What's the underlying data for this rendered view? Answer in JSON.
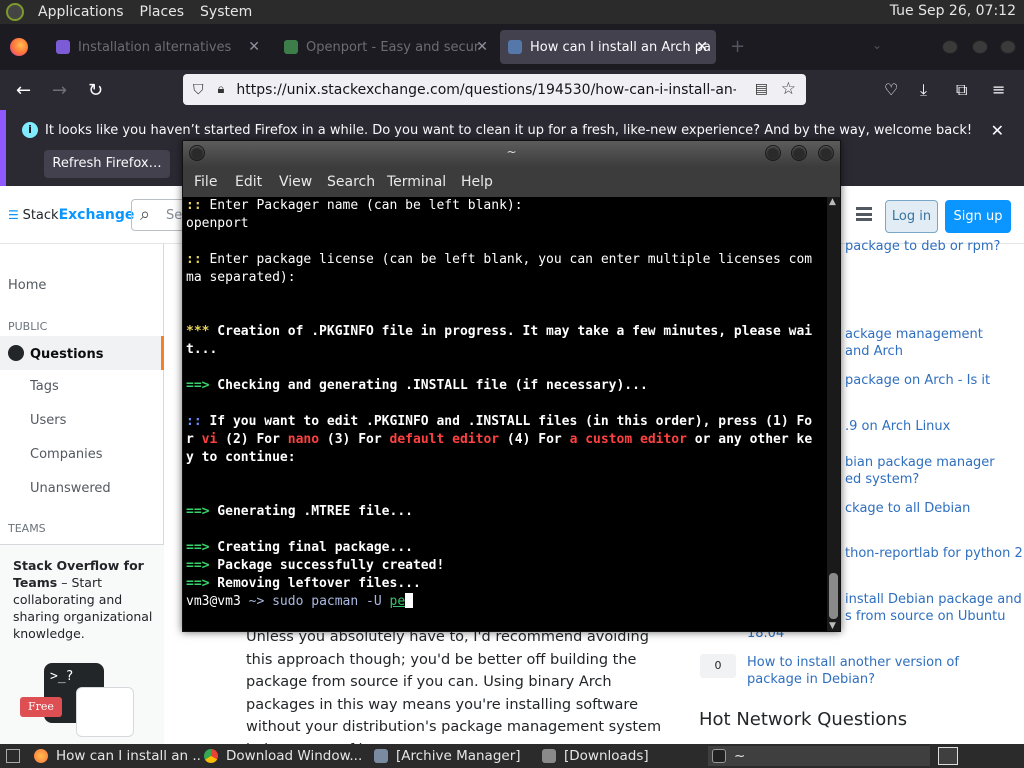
{
  "top_panel": {
    "menus": [
      "Applications",
      "Places",
      "System"
    ],
    "clock": "Tue Sep 26, 07:12"
  },
  "browser": {
    "tabs": [
      {
        "label": "Installation alternatives",
        "active": false
      },
      {
        "label": "Openport - Easy and secur",
        "active": false
      },
      {
        "label": "How can I install an Arch pa",
        "active": true
      }
    ],
    "url": "https://unix.stackexchange.com/questions/194530/how-can-i-install-an-arch-pa",
    "notification": {
      "message": "It looks like you haven’t started Firefox in a while. Do you want to clean it up for a fresh, like-new experience? And by the way, welcome back!",
      "button": "Refresh Firefox…"
    }
  },
  "site": {
    "logo_a": "Stack",
    "logo_b": "Exchange",
    "search_placeholder": "Se",
    "login": "Log in",
    "signup": "Sign up",
    "nav": {
      "home": "Home",
      "public_header": "PUBLIC",
      "questions": "Questions",
      "tags": "Tags",
      "users": "Users",
      "companies": "Companies",
      "unanswered": "Unanswered",
      "teams_header": "TEAMS"
    },
    "teams": {
      "title": "Stack Overflow for Teams",
      "body": " – Start collaborating and sharing organizational knowledge.",
      "prompt": ">_?",
      "free": "Free"
    },
    "answer_text": "Unless you absolutely have to, I'd recommend avoiding this approach though; you'd be better off building the package from source if you can. Using binary Arch packages in this way means you're installing software without your distribution's package management system being aware of it,",
    "related": [
      "package to deb or rpm?",
      "ackage management",
      "and Arch",
      "package on Arch - Is it",
      ".9 on Arch Linux",
      "bian package manager",
      "ed system?",
      "ckage to all Debian",
      "thon-reportlab for python 2",
      "install Debian package and",
      "s from source on Ubuntu",
      "18.04",
      "How to install another version of package in Debian?"
    ],
    "vote": "0",
    "hot_network": "Hot Network Questions"
  },
  "terminal": {
    "title": "~",
    "menus": [
      "File",
      "Edit",
      "View",
      "Search",
      "Terminal",
      "Help"
    ],
    "lines": {
      "l1_prefix": "::",
      "l1_text": " Enter Packager name (can be left blank):",
      "l2": "openport",
      "l3_prefix": "::",
      "l3_text": " Enter package license (can be left blank, you can enter multiple licenses com",
      "l4": "ma separated):",
      "l5_prefix": "***",
      "l5_text": " Creation of .PKGINFO file in progress. It may take a few minutes, please wai",
      "l6": "t...",
      "l7_prefix": "==>",
      "l7_text": " Checking and generating .INSTALL file (if necessary)...",
      "l8_prefix": "::",
      "l8_text": " If you want to edit .PKGINFO and .INSTALL files (in this order), press (1) Fo",
      "l9_a": "r ",
      "l9_vi": "vi",
      "l9_b": " (2) For ",
      "l9_nano": "nano",
      "l9_c": " (3) For ",
      "l9_def": "default editor",
      "l9_d": " (4) For ",
      "l9_custom": "a custom editor",
      "l9_e": " or any other ke",
      "l10": "y to continue:",
      "l11_prefix": "==>",
      "l11_text": " Generating .MTREE file...",
      "l12_prefix": "==>",
      "l12_text": " Creating final package...",
      "l13_prefix": "==>",
      "l13_text": " Package successfully created!",
      "l14_prefix": "==>",
      "l14_text": " Removing leftover files...",
      "prompt_user": "vm3@vm3",
      "prompt_arrow": " ~> ",
      "command": "sudo pacman -U ",
      "typed": "pe"
    }
  },
  "taskbar": {
    "items": [
      {
        "label": "How can I install an ...",
        "icon": "firefox-icon"
      },
      {
        "label": "Download Window...",
        "icon": "chrome-icon"
      },
      {
        "label": "[Archive Manager]",
        "icon": "archive-icon"
      },
      {
        "label": "[Downloads]",
        "icon": "folder-icon"
      },
      {
        "label": "~",
        "icon": "terminal-icon"
      }
    ]
  },
  "colors": {
    "accent_purple": "#9059ff",
    "se_blue": "#0a95ff",
    "so_orange": "#f48225"
  }
}
